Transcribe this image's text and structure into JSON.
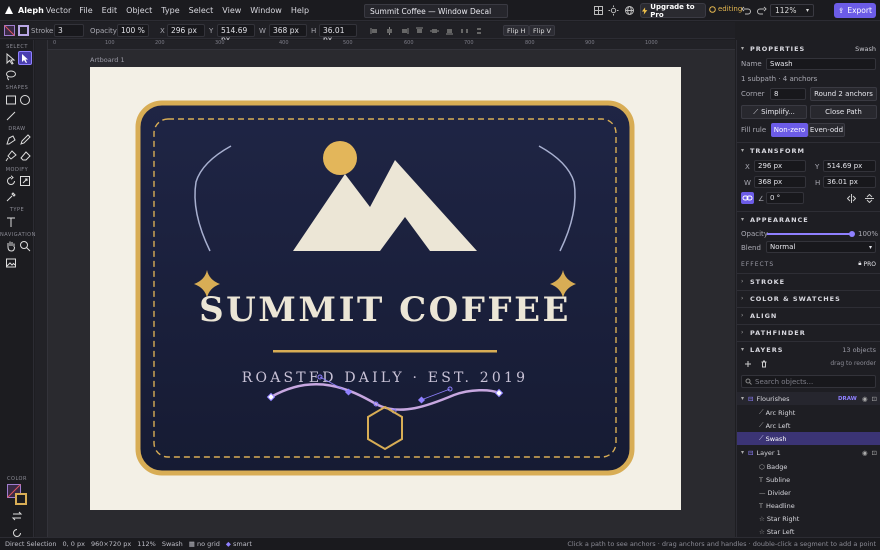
{
  "app": {
    "brand": "Aleph",
    "brand_sub": "Vector"
  },
  "menu": [
    "File",
    "Edit",
    "Object",
    "Type",
    "Select",
    "View",
    "Window",
    "Help"
  ],
  "doc_title": "Summit Coffee — Window Decal",
  "upgrade_label": "Upgrade to Pro",
  "editing_label": "editing",
  "zoom": "112%",
  "export_label": "Export",
  "options": {
    "stroke_label": "Stroke",
    "stroke_value": "3",
    "opacity_label": "Opacity",
    "opacity_value": "100 %",
    "x_label": "X",
    "x_value": "296 px",
    "y_label": "Y",
    "y_value": "514.69 px",
    "w_label": "W",
    "w_value": "368 px",
    "h_label": "H",
    "h_value": "36.01 px",
    "flip_h": "Flip H",
    "flip_v": "Flip V"
  },
  "toolbar": {
    "select": "SELECT",
    "shapes": "SHAPES",
    "draw": "DRAW",
    "modify": "MODIFY",
    "type": "TYPE",
    "navigation": "NAVIGATION",
    "color": "COLOR"
  },
  "ruler_ticks": [
    "0",
    "100",
    "200",
    "300",
    "400",
    "500",
    "600",
    "700",
    "800",
    "900",
    "1000"
  ],
  "artboard": {
    "label": "Artboard 1",
    "headline": "SUMMIT COFFEE",
    "subline": "ROASTED DAILY · EST. 2019"
  },
  "properties": {
    "title": "PROPERTIES",
    "selected": "Swash",
    "name_label": "Name",
    "name_value": "Swash",
    "subpath_info": "1 subpath · 4 anchors",
    "corner_label": "Corner",
    "corner_value": "8",
    "round_btn": "Round 2 anchors",
    "simplify_btn": "Simplify...",
    "close_path_btn": "Close Path",
    "fill_rule_label": "Fill rule",
    "nonzero": "Non-zero",
    "evenodd": "Even-odd"
  },
  "transform": {
    "title": "TRANSFORM",
    "x_label": "X",
    "x_value": "296 px",
    "y_label": "Y",
    "y_value": "514.69 px",
    "w_label": "W",
    "w_value": "368 px",
    "h_label": "H",
    "h_value": "36.01 px",
    "angle_label": "∠",
    "angle_value": "0 °"
  },
  "appearance": {
    "title": "APPEARANCE",
    "opacity_label": "Opacity",
    "opacity_value": "100%",
    "opacity_fraction": 1.0,
    "blend_label": "Blend",
    "blend_value": "Normal",
    "effects_label": "EFFECTS",
    "pro_badge": "PRO"
  },
  "collapsed_sections": [
    "STROKE",
    "COLOR & SWATCHES",
    "ALIGN",
    "PATHFINDER"
  ],
  "layers": {
    "title": "LAYERS",
    "count": "13 objects",
    "reorder_hint": "drag to reorder",
    "search_placeholder": "Search objects...",
    "groups": [
      {
        "name": "Flourishes",
        "badge": "DRAW",
        "children": [
          "Arc Right",
          "Arc Left",
          "Swash"
        ]
      },
      {
        "name": "Layer 1",
        "badge": "",
        "children": [
          "Badge",
          "Subline",
          "Divider",
          "Headline",
          "Star Right",
          "Star Left"
        ]
      }
    ]
  },
  "status": {
    "mode": "Direct Selection",
    "coords": "0, 0 px",
    "size": "960×720 px",
    "zoom": "112%",
    "selection": "Swash",
    "grid": "no grid",
    "snap": "smart",
    "hint": "Click a path to see anchors · drag anchors and handles · double-click a segment to add a point"
  },
  "colors": {
    "accent": "#6c5ce7",
    "badge_navy": "#1c2140",
    "gold": "#d8ad55",
    "cream": "#f3f0e6"
  }
}
